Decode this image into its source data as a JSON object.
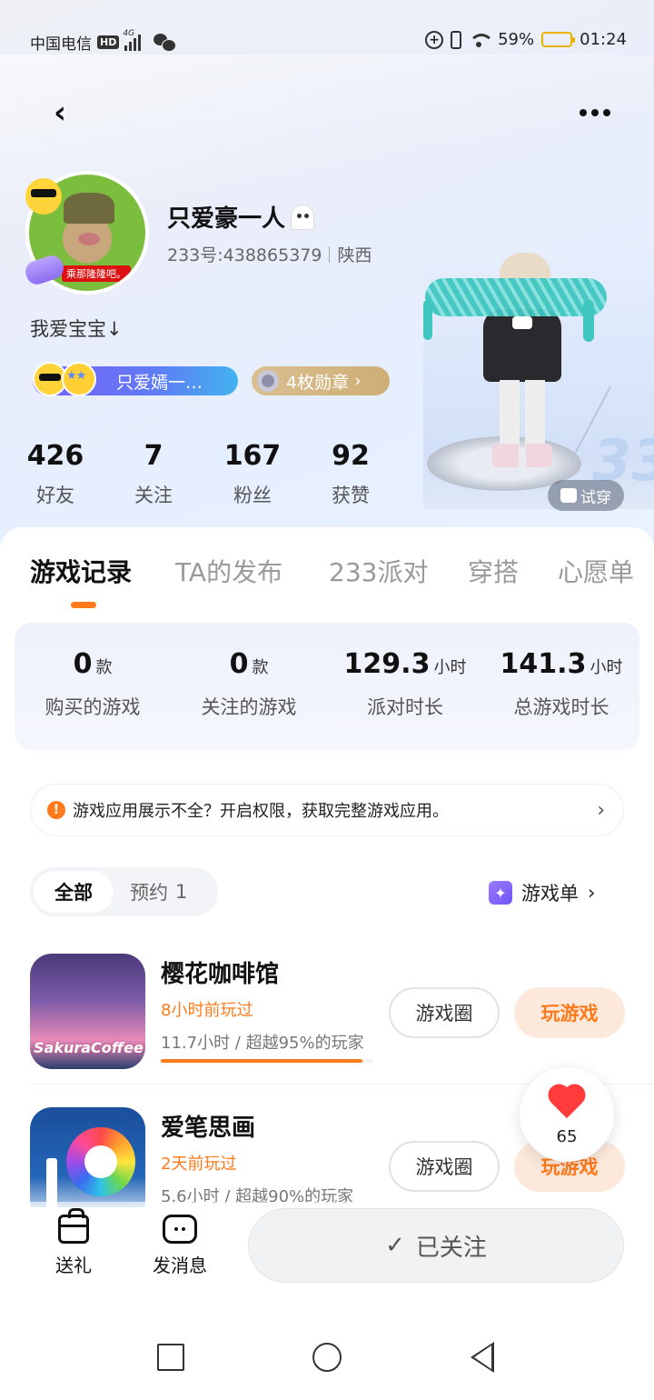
{
  "status_bar": {
    "carrier": "中国电信",
    "hd": "HD",
    "network": "4G",
    "battery": "59%",
    "time": "01:24"
  },
  "profile": {
    "avatar_tag": "乘那隆隆吧。",
    "nickname": "只爱豪一人",
    "uid": "233号:438865379",
    "region": "陕西",
    "bio": "我爱宝宝↓",
    "title_badge": "只爱嫣一…",
    "medals": "4枚勋章",
    "stats": [
      {
        "value": "426",
        "label": "好友"
      },
      {
        "value": "7",
        "label": "关注"
      },
      {
        "value": "167",
        "label": "粉丝"
      },
      {
        "value": "92",
        "label": "获赞"
      }
    ],
    "try_on": "试穿",
    "watermark": "33"
  },
  "tabs": [
    "游戏记录",
    "TA的发布",
    "233派对",
    "穿搭",
    "心愿单"
  ],
  "summary": [
    {
      "value": "0",
      "unit": "款",
      "label": "购买的游戏"
    },
    {
      "value": "0",
      "unit": "款",
      "label": "关注的游戏"
    },
    {
      "value": "129.3",
      "unit": "小时",
      "label": "派对时长"
    },
    {
      "value": "141.3",
      "unit": "小时",
      "label": "总游戏时长"
    }
  ],
  "notice": {
    "icon": "!",
    "text": "游戏应用展示不全？开启权限，获取完整游戏应用。"
  },
  "filters": {
    "all": "全部",
    "reserve": "预约",
    "reserve_count": "1",
    "game_list": "游戏单"
  },
  "games": [
    {
      "name": "樱花咖啡馆",
      "last_played": "8小时前玩过",
      "playtime": "11.7小时 / 超越95%的玩家",
      "progress": 0.95,
      "circle_btn": "游戏圈",
      "play_btn": "玩游戏"
    },
    {
      "name": "爱笔思画",
      "last_played": "2天前玩过",
      "playtime": "5.6小时 / 超越90%的玩家",
      "progress": 0.9,
      "circle_btn": "游戏圈",
      "play_btn": "玩游戏"
    }
  ],
  "like": {
    "count": "65"
  },
  "actions": {
    "gift": "送礼",
    "message": "发消息",
    "followed": "已关注"
  },
  "colors": {
    "accent": "#ff7a1a",
    "title_badge": "#7a5ef6",
    "medal": "#d9bf8f"
  }
}
